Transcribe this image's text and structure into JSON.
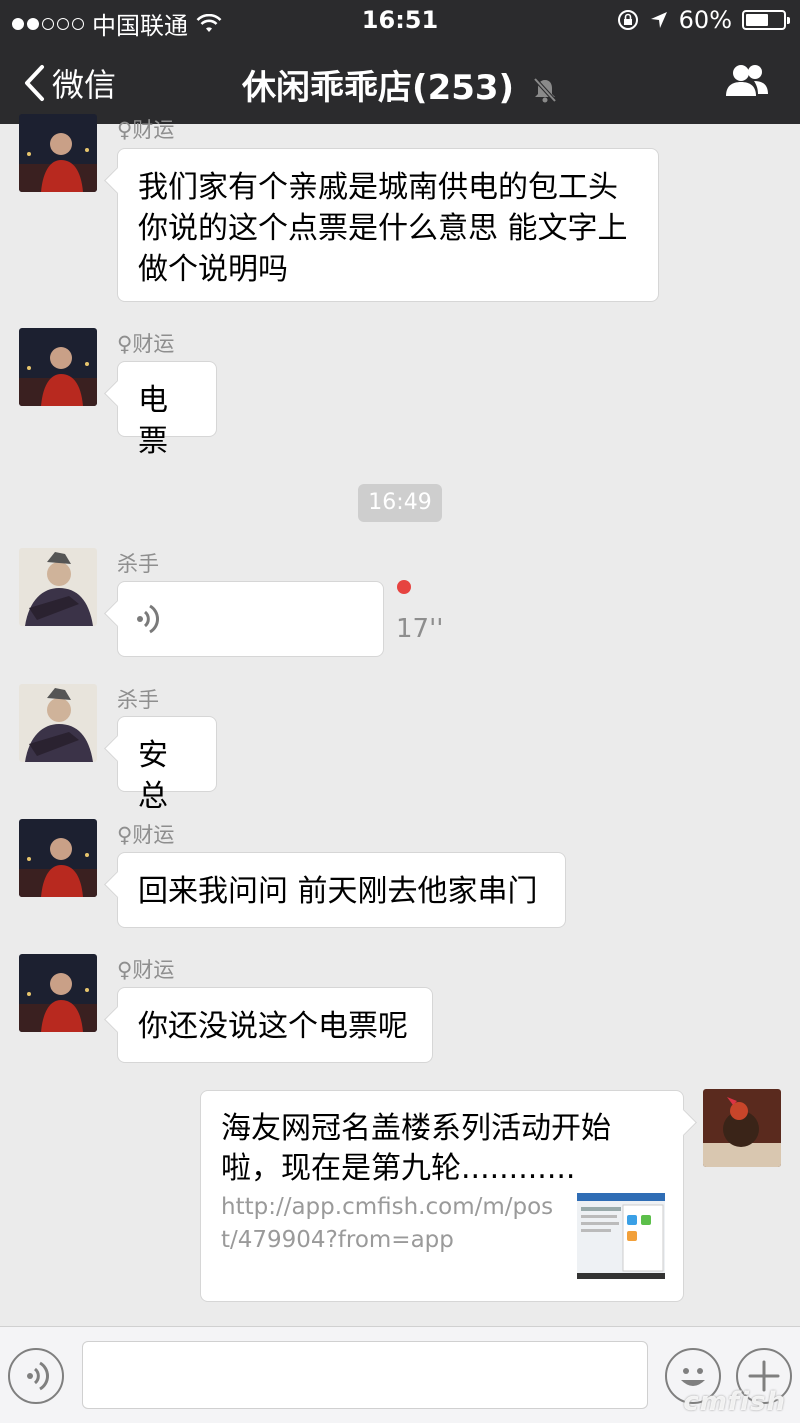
{
  "status_bar": {
    "carrier": "中国联通",
    "time": "16:51",
    "battery_percent": "60%",
    "battery_level": 0.6
  },
  "nav": {
    "back_label": "微信",
    "title": "休闲乖乖店(253)"
  },
  "messages": [
    {
      "sender": "♀财运",
      "text_lines": [
        "我们家有个亲戚是城南供电的包工头",
        "你说的这个点票是什么意思 能文字上",
        "做个说明吗"
      ]
    },
    {
      "sender": "♀财运",
      "text": "电票"
    },
    {
      "time_divider": "16:49"
    },
    {
      "sender": "杀手",
      "voice_duration": "17''"
    },
    {
      "sender": "杀手",
      "text": "安总"
    },
    {
      "sender": "♀财运",
      "text": "回来我问问 前天刚去他家串门"
    },
    {
      "sender": "♀财运",
      "text": "你还没说这个电票呢"
    },
    {
      "link_title_lines": [
        "海友网冠名盖楼系列活动开始",
        "啦，现在是第九轮............"
      ],
      "link_url": "http://app.cmfish.com/m/post/479904?from=app"
    }
  ],
  "input_bar": {
    "watermark": "cmfish"
  },
  "colors": {
    "header_bg": "#2b2b2d",
    "chat_bg": "#ebebeb",
    "unread": "#e64340"
  }
}
